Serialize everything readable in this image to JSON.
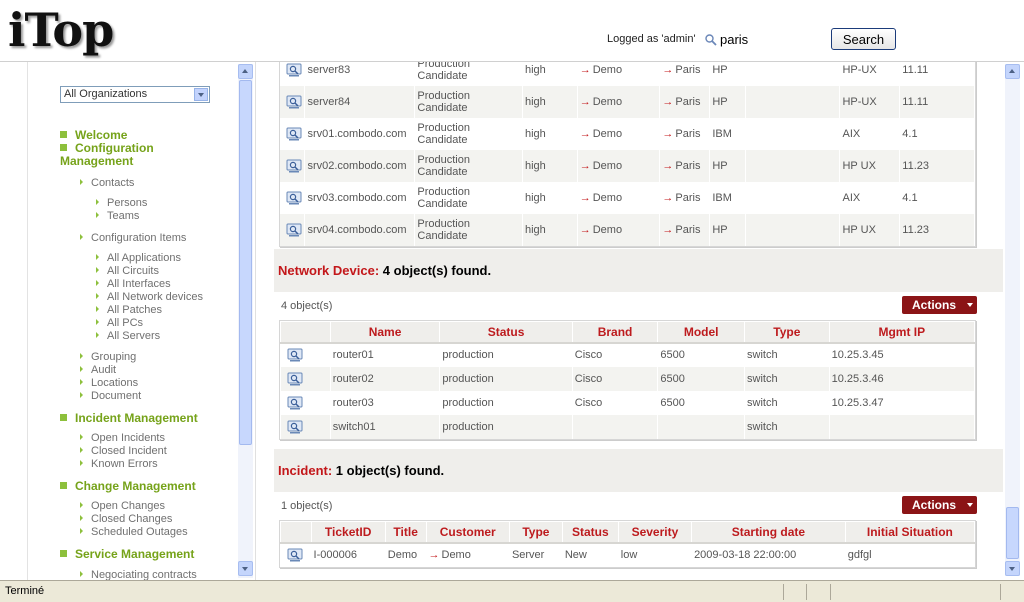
{
  "header": {
    "logo": "iTop",
    "logged_as": "Logged as 'admin'",
    "search_value": "paris",
    "search_button": "Search"
  },
  "sidebar": {
    "org_select": "All Organizations",
    "sections": [
      {
        "label": "Welcome"
      },
      {
        "label": "Configuration"
      },
      {
        "label": "Management"
      },
      {
        "label": "Incident Management"
      },
      {
        "label": "Change Management"
      },
      {
        "label": "Service Management"
      }
    ],
    "config_groups": {
      "contacts": "Contacts",
      "persons": "Persons",
      "teams": "Teams",
      "config_items": "Configuration Items",
      "all_applications": "All Applications",
      "all_circuits": "All Circuits",
      "all_interfaces": "All Interfaces",
      "all_network_devices": "All Network devices",
      "all_patches": "All Patches",
      "all_pcs": "All PCs",
      "all_servers": "All Servers",
      "grouping": "Grouping",
      "audit": "Audit",
      "locations": "Locations",
      "document": "Document"
    },
    "incident_items": [
      "Open Incidents",
      "Closed Incident",
      "Known Errors"
    ],
    "change_items": [
      "Open Changes",
      "Closed Changes",
      "Scheduled Outages"
    ],
    "service_items": [
      "Negociating contracts"
    ]
  },
  "servers_table": {
    "rows": [
      {
        "name": "server83",
        "status1": "Production",
        "status2": "Candidate",
        "criticity": "high",
        "org": "Demo",
        "location": "Paris",
        "brand": "HP",
        "os": "HP-UX",
        "version": "11.11"
      },
      {
        "name": "server84",
        "status1": "Production",
        "status2": "Candidate",
        "criticity": "high",
        "org": "Demo",
        "location": "Paris",
        "brand": "HP",
        "os": "HP-UX",
        "version": "11.11"
      },
      {
        "name": "srv01.combodo.com",
        "status1": "Production",
        "status2": "Candidate",
        "criticity": "high",
        "org": "Demo",
        "location": "Paris",
        "brand": "IBM",
        "os": "AIX",
        "version": "4.1"
      },
      {
        "name": "srv02.combodo.com",
        "status1": "Production",
        "status2": "Candidate",
        "criticity": "high",
        "org": "Demo",
        "location": "Paris",
        "brand": "HP",
        "os": "HP UX",
        "version": "11.23"
      },
      {
        "name": "srv03.combodo.com",
        "status1": "Production",
        "status2": "Candidate",
        "criticity": "high",
        "org": "Demo",
        "location": "Paris",
        "brand": "IBM",
        "os": "AIX",
        "version": "4.1"
      },
      {
        "name": "srv04.combodo.com",
        "status1": "Production",
        "status2": "Candidate",
        "criticity": "high",
        "org": "Demo",
        "location": "Paris",
        "brand": "HP",
        "os": "HP UX",
        "version": "11.23"
      }
    ]
  },
  "network": {
    "class_label": "Network Device:",
    "found_label": "4 object(s) found.",
    "count": "4 object(s)",
    "actions": "Actions",
    "columns": [
      "Name",
      "Status",
      "Brand",
      "Model",
      "Type",
      "Mgmt IP"
    ],
    "rows": [
      {
        "name": "router01",
        "status": "production",
        "brand": "Cisco",
        "model": "6500",
        "type": "switch",
        "ip": "10.25.3.45"
      },
      {
        "name": "router02",
        "status": "production",
        "brand": "Cisco",
        "model": "6500",
        "type": "switch",
        "ip": "10.25.3.46"
      },
      {
        "name": "router03",
        "status": "production",
        "brand": "Cisco",
        "model": "6500",
        "type": "switch",
        "ip": "10.25.3.47"
      },
      {
        "name": "switch01",
        "status": "production",
        "brand": "",
        "model": "",
        "type": "switch",
        "ip": ""
      }
    ]
  },
  "incident": {
    "class_label": "Incident:",
    "found_label": "1 object(s) found.",
    "count": "1 object(s)",
    "actions": "Actions",
    "columns": [
      "TicketID",
      "Title",
      "Customer",
      "Type",
      "Status",
      "Severity",
      "Starting date",
      "Initial Situation"
    ],
    "rows": [
      {
        "ticket": "I-000006",
        "title": "Demo",
        "customer": "Demo",
        "type": "Server",
        "status": "New",
        "severity": "low",
        "start": "2009-03-18 22:00:00",
        "situation": "gdfgl"
      }
    ]
  },
  "statusbar": {
    "text": "Terminé"
  },
  "colors": {
    "accent_red": "#c3171a",
    "menu_green": "#76a31a",
    "actions_bg": "#8b1416"
  }
}
